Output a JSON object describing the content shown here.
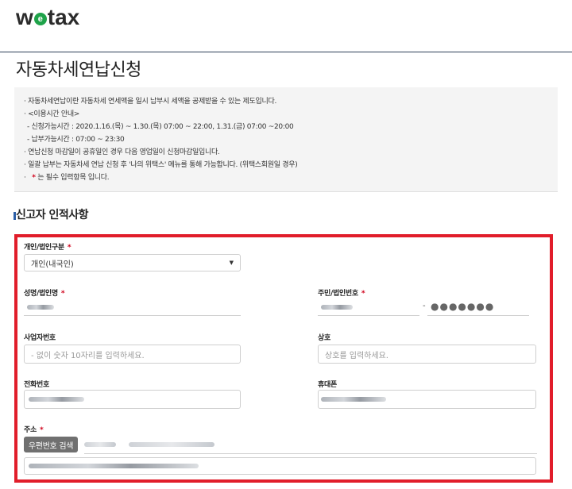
{
  "header": {
    "logo_pre": "w",
    "logo_e": "e",
    "logo_post": "tax"
  },
  "page": {
    "title": "자동차세연납신청"
  },
  "info": {
    "lines": [
      "· 자동차세연납이란 자동차세 연세액을 일시 납부시 세액을 공제받을 수 있는 제도입니다.",
      "· <이용시간 안내>",
      "  - 신청가능시간 : 2020.1.16.(목) ~ 1.30.(목) 07:00 ~ 22:00, 1.31.(금) 07:00 ~20:00",
      "  - 납부가능시간 : 07:00 ~ 23:30",
      "· 연납신청 마감일이 공휴일인 경우 다음 영업일이 신청마감일입니다.",
      "· 일괄 납부는 자동차세 연납 신청 후 '나의 위택스' 메뉴를 통해 가능합니다. (위택스회원일 경우)"
    ],
    "required_star": "*",
    "required_note": " 는 필수 입력항목 입니다."
  },
  "section": {
    "title": "신고자 인적사항"
  },
  "form": {
    "required_mark": "*",
    "type_label": "개인/법인구분",
    "type_value": "개인(내국인)",
    "name_label": "성명/법인명",
    "idno_label": "주민/법인번호",
    "idno_dash": "-",
    "idno_masked": "●●●●●●●",
    "bizno_label": "사업자번호",
    "bizno_placeholder": "- 없이 숫자 10자리를 입력하세요.",
    "company_label": "상호",
    "company_placeholder": "상호를 입력하세요.",
    "phone_label": "전화번호",
    "mobile_label": "휴대폰",
    "address_label": "주소",
    "postcode_button": "우편번호 검색"
  }
}
